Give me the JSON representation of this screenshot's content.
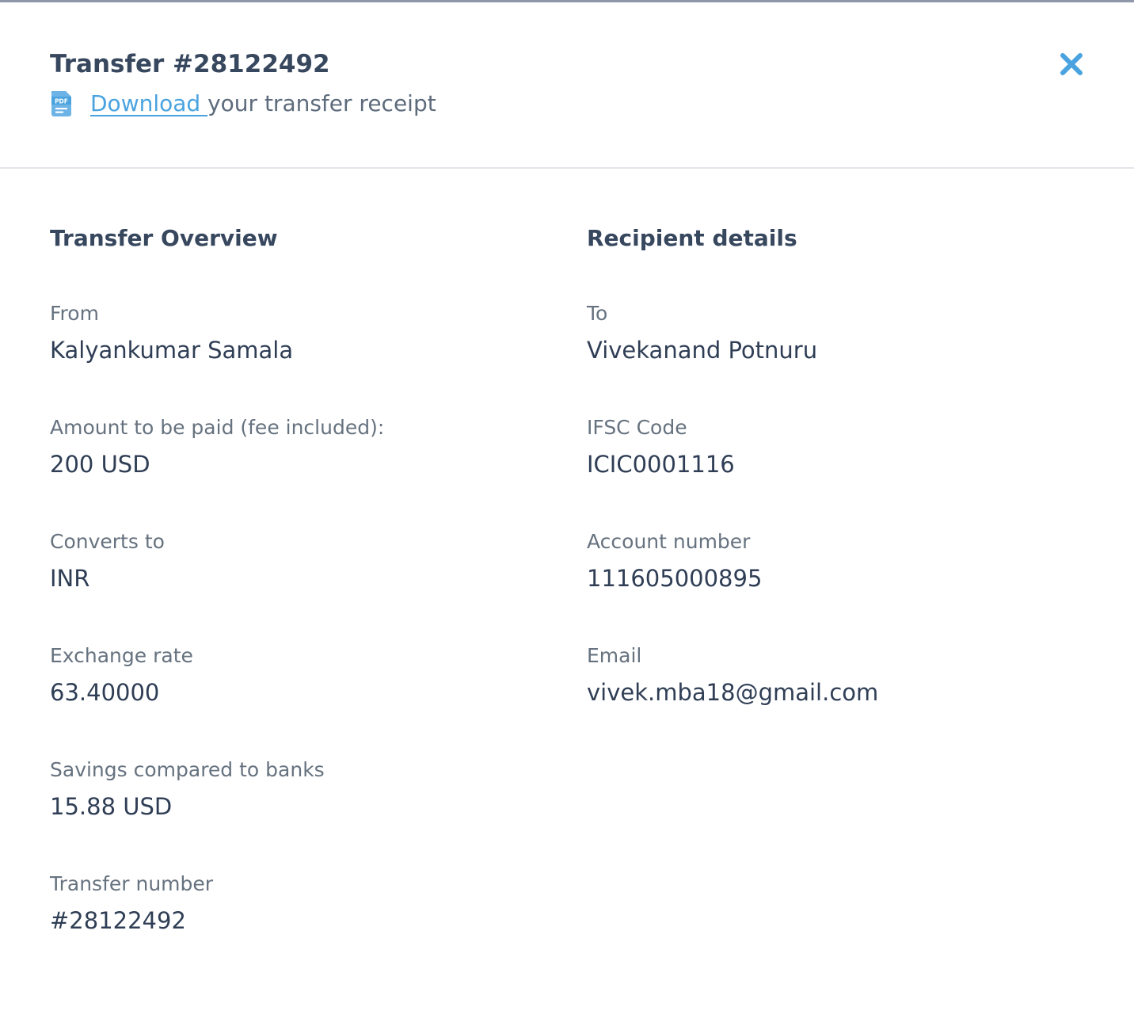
{
  "modal": {
    "title": "Transfer #28122492",
    "download_link_label": "Download ",
    "download_rest": "your transfer receipt",
    "pdf_icon": "pdf-file-icon",
    "close_icon": "close-icon"
  },
  "overview": {
    "heading": "Transfer Overview",
    "fields": [
      {
        "label": "From",
        "value": "Kalyankumar Samala"
      },
      {
        "label": "Amount to be paid (fee included):",
        "value": "200 USD"
      },
      {
        "label": "Converts to",
        "value": "INR"
      },
      {
        "label": "Exchange rate",
        "value": "63.40000"
      },
      {
        "label": "Savings compared to banks",
        "value": "15.88 USD"
      },
      {
        "label": "Transfer number",
        "value": "#28122492"
      }
    ]
  },
  "recipient": {
    "heading": "Recipient details",
    "fields": [
      {
        "label": "To",
        "value": "Vivekanand Potnuru"
      },
      {
        "label": "IFSC Code",
        "value": "ICIC0001116"
      },
      {
        "label": "Account number",
        "value": "111605000895"
      },
      {
        "label": "Email",
        "value": "vivek.mba18@gmail.com"
      }
    ]
  },
  "colors": {
    "accent": "#4aa3df",
    "text_dark": "#37475e",
    "text_muted": "#66727f"
  }
}
